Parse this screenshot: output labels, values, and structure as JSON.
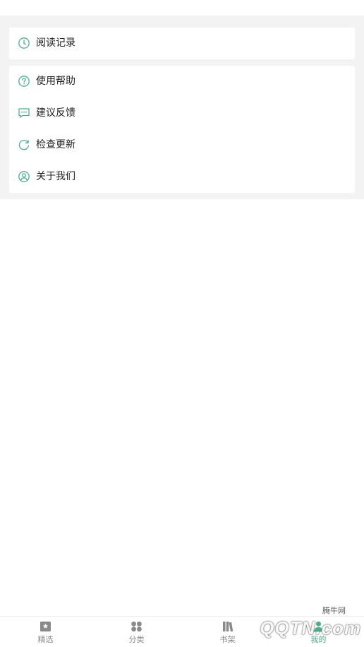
{
  "history_card": {
    "label": "阅读记录",
    "icon": "clock-icon"
  },
  "menu": [
    {
      "label": "使用帮助",
      "icon": "question-circle-icon"
    },
    {
      "label": "建议反馈",
      "icon": "chat-bubble-icon"
    },
    {
      "label": "检查更新",
      "icon": "refresh-icon"
    },
    {
      "label": "关于我们",
      "icon": "user-circle-icon"
    }
  ],
  "tabbar": [
    {
      "label": "精选",
      "icon": "book-star-icon",
      "active": false
    },
    {
      "label": "分类",
      "icon": "grid-dots-icon",
      "active": false
    },
    {
      "label": "书架",
      "icon": "bookshelf-icon",
      "active": false
    },
    {
      "label": "我的",
      "icon": "person-icon",
      "active": true
    }
  ],
  "watermark": {
    "cn_text": "腾牛网",
    "main_text": "QQTN.com"
  },
  "colors": {
    "accent": "#4caf8a",
    "page_bg": "#f3f3f3",
    "card_bg": "#ffffff",
    "inactive_tab": "#8a8a8a"
  }
}
